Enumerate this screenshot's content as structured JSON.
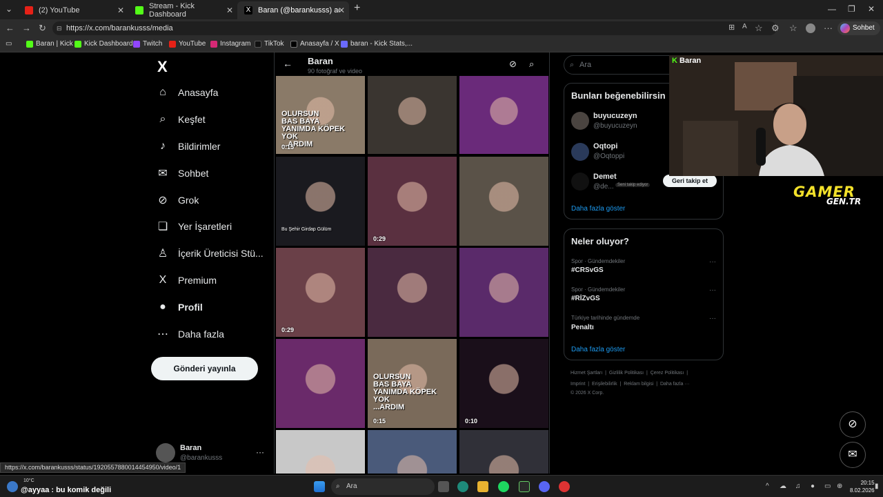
{
  "browser": {
    "tabs": [
      {
        "title": "(2) YouTube",
        "active": false
      },
      {
        "title": "Stream - Kick Dashboard",
        "active": false
      },
      {
        "title": "Baran (@barankusss) adlı kullanıcı",
        "active": true
      }
    ],
    "url": "https://x.com/barankusss/media",
    "chat_button": "Sohbet et",
    "bookmarks": [
      "Baran | Kick",
      "Kick Dashboard",
      "Twitch",
      "YouTube",
      "Instagram",
      "TikTok",
      "Anasayfa / X",
      "baran - Kick Stats,..."
    ],
    "status_url": "https://x.com/barankusss/status/1920557880014454950/video/1"
  },
  "nav": {
    "logo": "X",
    "items": [
      {
        "label": "Anasayfa",
        "icon": "home-icon",
        "glyph": "⌂"
      },
      {
        "label": "Keşfet",
        "icon": "search-icon",
        "glyph": "⌕"
      },
      {
        "label": "Bildirimler",
        "icon": "bell-icon",
        "glyph": "♪"
      },
      {
        "label": "Sohbet",
        "icon": "mail-icon",
        "glyph": "✉"
      },
      {
        "label": "Grok",
        "icon": "grok-icon",
        "glyph": "⊘"
      },
      {
        "label": "Yer İşaretleri",
        "icon": "bookmark-icon",
        "glyph": "❏"
      },
      {
        "label": "İçerik Üreticisi Stü...",
        "icon": "creator-icon",
        "glyph": "♙"
      },
      {
        "label": "Premium",
        "icon": "x-premium-icon",
        "glyph": "X"
      },
      {
        "label": "Profil",
        "icon": "profile-icon",
        "glyph": "●"
      },
      {
        "label": "Daha fazla",
        "icon": "more-circle-icon",
        "glyph": "⋯"
      }
    ],
    "post_button": "Gönderi yayınla",
    "profile_name": "Baran",
    "profile_handle": "@barankusss",
    "profile_more": "···"
  },
  "media": {
    "title": "Baran",
    "subtitle": "90 fotoğraf ve video",
    "tiles": [
      {
        "bg": "#8a7a68",
        "duration": "0:15",
        "caption": "OLURSUN\nBAS BAYA\nYANIMDA KÖPEK\nYOK\n...ARDIM"
      },
      {
        "bg": "#3a3530",
        "duration": "",
        "caption": ""
      },
      {
        "bg": "#6a2a7a",
        "duration": "",
        "caption": ""
      },
      {
        "bg": "#1a1a1f",
        "duration": "",
        "caption": "Bu Şehir Girdap Gülüm"
      },
      {
        "bg": "#5a3040",
        "duration": "0:29",
        "caption": ""
      },
      {
        "bg": "#5a5248",
        "duration": "",
        "caption": ""
      },
      {
        "bg": "#6a4048",
        "duration": "0:29",
        "caption": ""
      },
      {
        "bg": "#4a2a40",
        "duration": "",
        "caption": ""
      },
      {
        "bg": "#5a2a6a",
        "duration": "",
        "caption": ""
      },
      {
        "bg": "#6a2a6a",
        "duration": "",
        "caption": ""
      },
      {
        "bg": "#7a6a5a",
        "duration": "0:15",
        "caption": "OLURSUN\nBAS BAYA\nYANIMDA KÖPEK\nYOK\n...ARDIM"
      },
      {
        "bg": "#1a0f1a",
        "duration": "0:10",
        "caption": ""
      },
      {
        "bg": "#c8c8c8",
        "duration": "",
        "caption": ""
      },
      {
        "bg": "#4a5a7a",
        "duration": "",
        "caption": ""
      },
      {
        "bg": "#303038",
        "duration": "",
        "caption": ""
      }
    ]
  },
  "right": {
    "search_placeholder": "Ara",
    "suggest_title": "Bunları beğenebilirsin",
    "suggestions": [
      {
        "name": "buyucuzeyn",
        "handle": "@buyucuzeyn"
      },
      {
        "name": "Oqtopi",
        "handle": "@Oqtoppi"
      },
      {
        "name": "Demet",
        "handle": "@de..."
      }
    ],
    "follows_you_badge": "Seni takip ediyor",
    "follow_back": "Geri takip et",
    "show_more": "Daha fazla göster",
    "trends_title": "Neler oluyor?",
    "trends": [
      {
        "category": "Spor · Gündemdekiler",
        "name": "#CRSvGS"
      },
      {
        "category": "Spor · Gündemdekiler",
        "name": "#RİZvGS"
      },
      {
        "category": "Türkiye tarihinde gündemde",
        "name": "Penaltı"
      }
    ],
    "trends_show_more": "Daha fazla göster",
    "footer_line1": [
      "Hizmet Şartları",
      "Gizlilik Politikası",
      "Çerez Politikası"
    ],
    "footer_line2": [
      "Imprint",
      "Erişilebilirlik",
      "Reklam bilgisi",
      "Daha fazla ···"
    ],
    "copyright": "© 2026 X Corp."
  },
  "overlay": {
    "cam_label": "Baran",
    "brand_top": "GAMER",
    "brand_bottom": "GEN.TR"
  },
  "taskbar": {
    "weather": "10°C",
    "ticker": "@ayyaa : bu komik değili",
    "search": "Ara",
    "time": "20:15",
    "date": "8.02.2026"
  }
}
